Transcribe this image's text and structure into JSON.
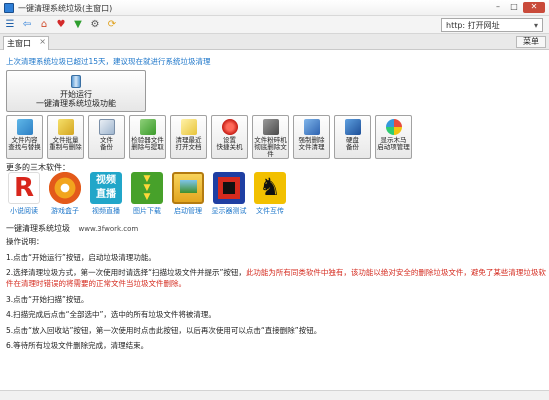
{
  "window": {
    "title": "一键清理系统垃圾(主窗口)"
  },
  "toolbar": {
    "icons": [
      "list-icon",
      "back-icon",
      "home-icon",
      "favorites-icon",
      "download-icon",
      "tools-icon",
      "sync-icon"
    ],
    "address_value": "http: 打开网址"
  },
  "tabs": [
    {
      "label": "主窗口"
    }
  ],
  "menu_label": "菜单",
  "main": {
    "last_clean_notice": "上次清理系统垃圾已超过15天，建议现在就进行系统垃圾清理",
    "start_button": {
      "line1": "开始运行",
      "line2": "一键清理系统垃圾功能"
    },
    "function_buttons": [
      {
        "line1": "文件内容",
        "line2": "查找与替换"
      },
      {
        "line1": "文件批量",
        "line2": "重制与删除"
      },
      {
        "line1": "文件",
        "line2": "备份"
      },
      {
        "line1": "检验器文件",
        "line2": "删除与提取"
      },
      {
        "line1": "清理最近",
        "line2": "打开文档"
      },
      {
        "line1": "设置",
        "line2": "快捷关机"
      },
      {
        "line1": "文件粉碎机",
        "line2": "彻底删除文件"
      },
      {
        "line1": "强制删除",
        "line2": "文件清理"
      },
      {
        "line1": "硬盘",
        "line2": "备份"
      },
      {
        "line1": "显示木马",
        "line2": "启动项管理"
      }
    ],
    "more_label": "更多的三木软件：",
    "more_software": [
      {
        "label": "小说阅读",
        "color": "#d8261c"
      },
      {
        "label": "游戏盒子",
        "color": "#e9a21f"
      },
      {
        "label": "视频直播",
        "color": "#21a6c9"
      },
      {
        "label": "图片下载",
        "color": "#47a12a"
      },
      {
        "label": "启动管理",
        "color": "#f2c12e"
      },
      {
        "label": "显示器测试",
        "color": "#1f3fa3"
      },
      {
        "label": "文件互传",
        "color": "#f2c000"
      }
    ],
    "site_label": "一键清理系统垃圾",
    "site_url": "www.3fwork.com",
    "instructions_title": "操作说明：",
    "steps": [
      {
        "text": "1.点击“开始运行”按钮，启动垃圾清理功能。",
        "warn": ""
      },
      {
        "text": "2.选择清理垃圾方式，第一次使用时请选择“扫描垃圾文件并提示”按钮，",
        "warn": "此功能为所有同类软件中独有，该功能以绝对安全的删除垃圾文件，避免了某些清理垃圾软件在清理时错误的将需要的正常文件当垃圾文件删除。"
      },
      {
        "text": "3.点击“开始扫描”按钮。",
        "warn": ""
      },
      {
        "text": "4.扫描完成后点击“全部选中”，选中的所有垃圾文件将被清理。",
        "warn": ""
      },
      {
        "text": "5.点击“放入回收站”按钮，第一次使用时点击此按钮，以后再次使用可以点击“直接删除”按钮。",
        "warn": ""
      },
      {
        "text": "6.等待所有垃圾文件删除完成，清理结束。",
        "warn": ""
      }
    ]
  }
}
